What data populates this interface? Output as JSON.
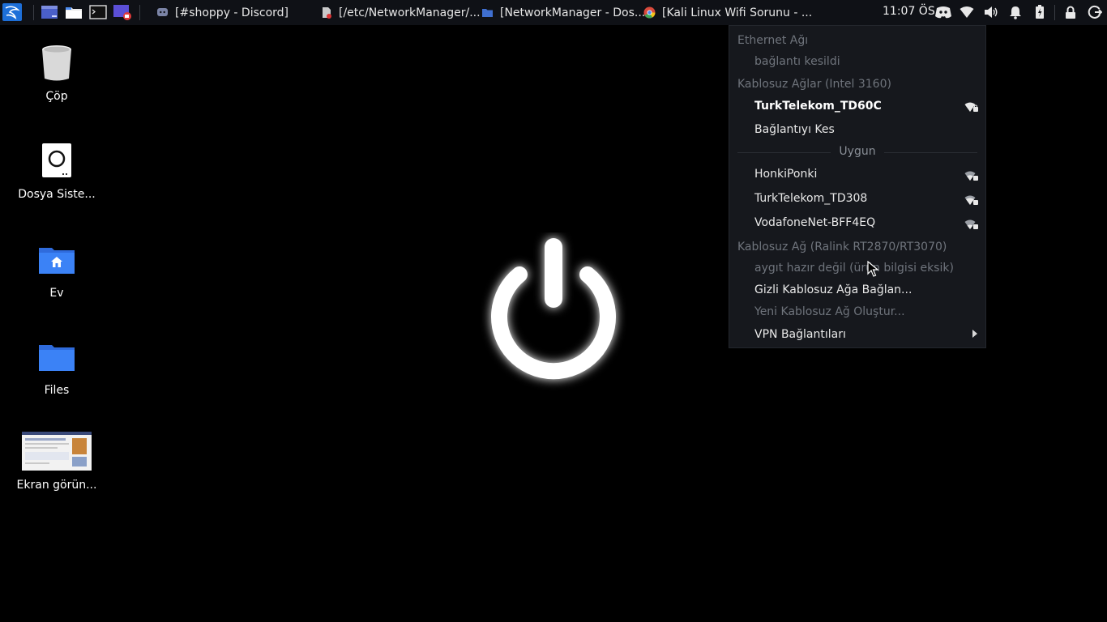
{
  "panel": {
    "tasks": [
      {
        "label": "[#shoppy - Discord]"
      },
      {
        "label": "[/etc/NetworkManager/..."
      },
      {
        "label": "[NetworkManager - Dos..."
      },
      {
        "label": "[Kali Linux Wifi Sorunu - ..."
      }
    ],
    "clock": "11:07 ÖS"
  },
  "desktop": {
    "icons": [
      {
        "label": "Çöp"
      },
      {
        "label": "Dosya Siste..."
      },
      {
        "label": "Ev"
      },
      {
        "label": "Files"
      },
      {
        "label": "Ekran görün..."
      }
    ]
  },
  "network_menu": {
    "ethernet_header": "Ethernet Ağı",
    "ethernet_status": "bağlantı kesildi",
    "wireless_header": "Kablosuz Ağlar (Intel 3160)",
    "connected_network": "TurkTelekom_TD60C",
    "disconnect": "Bağlantıyı Kes",
    "available_label": "Uygun",
    "available": [
      {
        "label": "HonkiPonki"
      },
      {
        "label": "TurkTelekom_TD308"
      },
      {
        "label": "VodafoneNet-BFF4EQ"
      }
    ],
    "wireless2_header": "Kablosuz Ağ (Ralink RT2870/RT3070)",
    "wireless2_status": "aygıt hazır değil (ürün bilgisi eksik)",
    "hidden_connect": "Gizli Kablosuz Ağa Bağlan...",
    "create_new": "Yeni Kablosuz Ağ Oluştur...",
    "vpn": "VPN Bağlantıları"
  },
  "colors": {
    "panel_bg": "#0f1116",
    "menu_bg": "#16181d",
    "accent_blue": "#3b82f6",
    "disabled_text": "#6f747c"
  }
}
